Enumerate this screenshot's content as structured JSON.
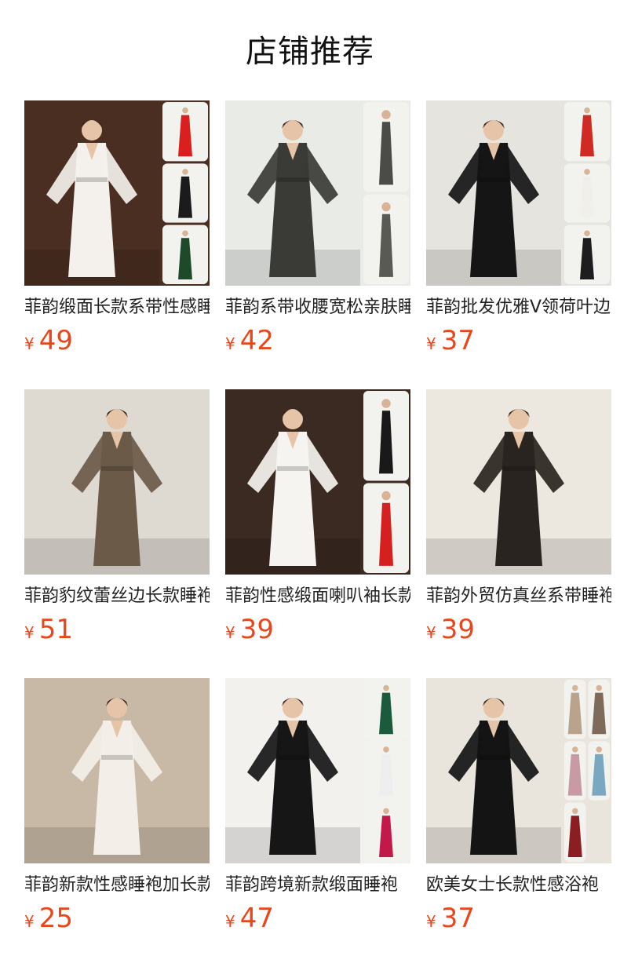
{
  "section_title": "店铺推荐",
  "currency_symbol": "¥",
  "products": [
    {
      "name": "菲韵缎面长款系带性感睡袍",
      "price": "49",
      "robe_color": "#f4f1ec",
      "bg_color": "#4a2e22",
      "side_colors": [
        "#d9201e",
        "#1b1b1b",
        "#1e4a2a"
      ]
    },
    {
      "name": "菲韵系带收腰宽松亲肤睡袍",
      "price": "42",
      "robe_color": "#3a3a36",
      "bg_color": "#e8ebe6",
      "side_colors": [
        "#4b4b48",
        "#5a5a55"
      ]
    },
    {
      "name": "菲韵批发优雅V领荷叶边睡袍",
      "price": "37",
      "robe_color": "#151515",
      "bg_color": "#e6e4de",
      "side_colors": [
        "#cf2a24",
        "#f1efea",
        "#1d1d1d"
      ]
    },
    {
      "name": "菲韵豹纹蕾丝边长款睡袍",
      "price": "51",
      "robe_color": "#6b5a48",
      "bg_color": "#dedad2",
      "side_colors": []
    },
    {
      "name": "菲韵性感缎面喇叭袖长款睡袍",
      "price": "39",
      "robe_color": "#f6f4f0",
      "bg_color": "#3a2a22",
      "side_colors": [
        "#191919",
        "#d62020"
      ]
    },
    {
      "name": "菲韵外贸仿真丝系带睡袍",
      "price": "39",
      "robe_color": "#2a2420",
      "bg_color": "#ece8e0",
      "side_colors": []
    },
    {
      "name": "菲韵新款性感睡袍加长款",
      "price": "25",
      "robe_color": "#f3efe8",
      "bg_color": "#c8b9a6",
      "side_colors": []
    },
    {
      "name": "菲韵跨境新款缎面睡袍",
      "price": "47",
      "robe_color": "#161616",
      "bg_color": "#f3f1ee",
      "side_colors": [
        "#1c5a3e",
        "#eeeeee",
        "#c2184a"
      ]
    },
    {
      "name": "欧美女士长款性感浴袍",
      "price": "37",
      "robe_color": "#141414",
      "bg_color": "#e9e4dc",
      "side_colors": [
        "#b9a38c",
        "#7d6a5a",
        "#c79aa4",
        "#7aa8c0",
        "#8a1e22"
      ]
    }
  ]
}
